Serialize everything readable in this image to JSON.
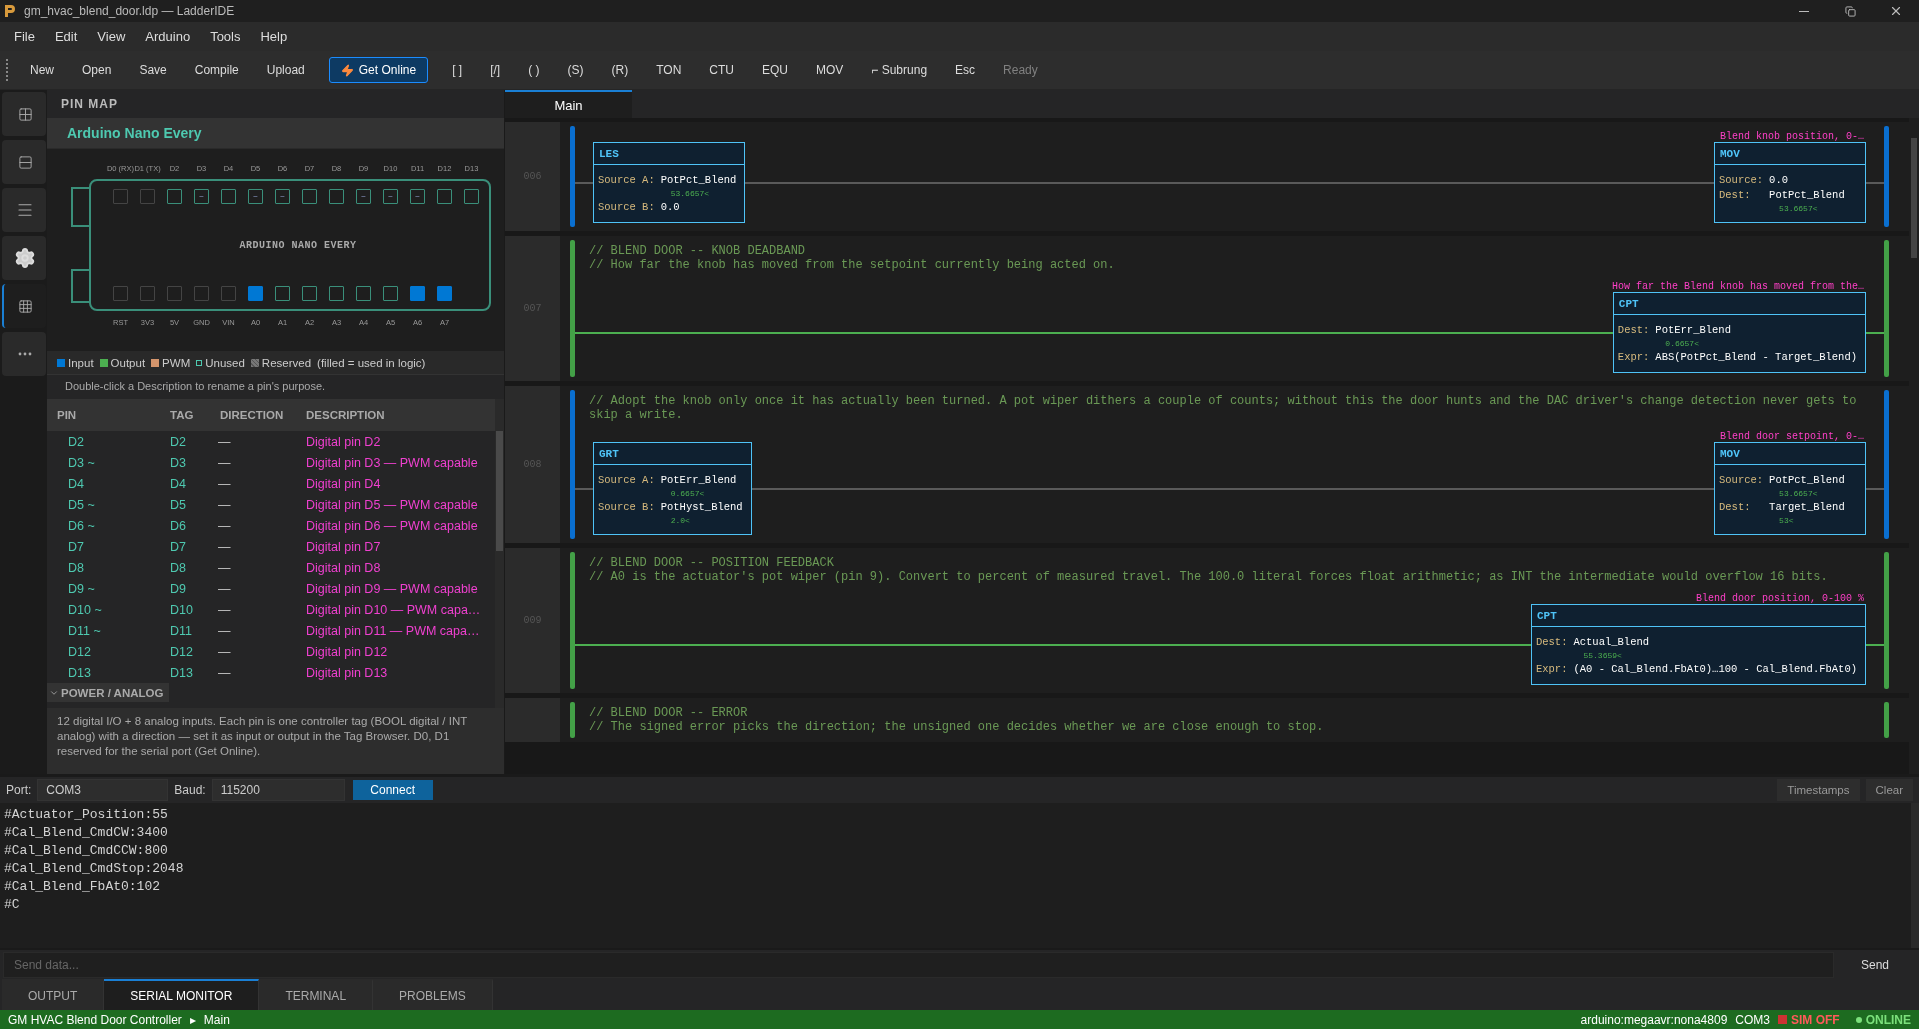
{
  "window": {
    "title": "gm_hvac_blend_door.ldp — LadderIDE"
  },
  "menu": [
    "File",
    "Edit",
    "View",
    "Arduino",
    "Tools",
    "Help"
  ],
  "toolbar": [
    {
      "label": "New",
      "kind": "action"
    },
    {
      "label": "Open",
      "kind": "action"
    },
    {
      "label": "Save",
      "kind": "action"
    },
    {
      "label": "Compile",
      "kind": "action"
    },
    {
      "label": "Upload",
      "kind": "action"
    },
    {
      "label": "Get Online",
      "kind": "primary"
    },
    {
      "label": "[ ]",
      "kind": "action"
    },
    {
      "label": "[/]",
      "kind": "action"
    },
    {
      "label": "( )",
      "kind": "action"
    },
    {
      "label": "(S)",
      "kind": "action"
    },
    {
      "label": "(R)",
      "kind": "action"
    },
    {
      "label": "TON",
      "kind": "action"
    },
    {
      "label": "CTU",
      "kind": "action"
    },
    {
      "label": "EQU",
      "kind": "action"
    },
    {
      "label": "MOV",
      "kind": "action"
    },
    {
      "label": "⌐ Subrung",
      "kind": "action"
    },
    {
      "label": "Esc",
      "kind": "action"
    },
    {
      "label": "Ready",
      "kind": "status"
    }
  ],
  "activity_bar": [
    {
      "kind": "grid",
      "selected": false
    },
    {
      "kind": "split",
      "selected": false
    },
    {
      "kind": "list",
      "selected": false
    },
    {
      "kind": "gear",
      "selected": false
    },
    {
      "kind": "table",
      "selected": true
    },
    {
      "kind": "more",
      "selected": false
    }
  ],
  "pin_map": {
    "title": "PIN MAP",
    "board_name": "Arduino Nano Every",
    "board_label": "ARDUINO NANO EVERY",
    "top_pins": [
      {
        "label": "D0 (RX)",
        "kind": "reserved"
      },
      {
        "label": "D1 (TX)",
        "kind": "reserved"
      },
      {
        "label": "D2",
        "kind": "unused"
      },
      {
        "label": "D3",
        "kind": "unused",
        "symbol": "~"
      },
      {
        "label": "D4",
        "kind": "unused"
      },
      {
        "label": "D5",
        "kind": "unused",
        "symbol": "~"
      },
      {
        "label": "D6",
        "kind": "unused",
        "symbol": "~"
      },
      {
        "label": "D7",
        "kind": "unused"
      },
      {
        "label": "D8",
        "kind": "unused"
      },
      {
        "label": "D9",
        "kind": "unused",
        "symbol": "~"
      },
      {
        "label": "D10",
        "kind": "unused",
        "symbol": "~"
      },
      {
        "label": "D11",
        "kind": "unused",
        "symbol": "~"
      },
      {
        "label": "D12",
        "kind": "unused"
      },
      {
        "label": "D13",
        "kind": "unused"
      }
    ],
    "bottom_pins": [
      {
        "label": "RST",
        "kind": "reserved"
      },
      {
        "label": "3V3",
        "kind": "reserved"
      },
      {
        "label": "5V",
        "kind": "reserved"
      },
      {
        "label": "GND",
        "kind": "reserved"
      },
      {
        "label": "VIN",
        "kind": "reserved"
      },
      {
        "label": "A0",
        "kind": "input"
      },
      {
        "label": "A1",
        "kind": "unused"
      },
      {
        "label": "A2",
        "kind": "unused"
      },
      {
        "label": "A3",
        "kind": "unused"
      },
      {
        "label": "A4",
        "kind": "unused"
      },
      {
        "label": "A5",
        "kind": "unused"
      },
      {
        "label": "A6",
        "kind": "input"
      },
      {
        "label": "A7",
        "kind": "input"
      }
    ],
    "legend": [
      {
        "label": "Input",
        "kind": "filled",
        "color": "#0078d4"
      },
      {
        "label": "Output",
        "kind": "filled",
        "color": "#4caf50"
      },
      {
        "label": "PWM",
        "kind": "filled",
        "color": "#d4956c"
      },
      {
        "label": "Unused",
        "kind": "outline",
        "color": "#4ec9b0"
      },
      {
        "label": "Reserved",
        "kind": "hatched",
        "color": "#777777"
      }
    ],
    "legend_note": "(filled = used in logic)",
    "hint": "Double-click a Description to rename a pin's purpose.",
    "table": {
      "columns": [
        "PIN",
        "TAG",
        "DIRECTION",
        "DESCRIPTION"
      ],
      "rows": [
        {
          "pin": "D2",
          "tag": "D2",
          "direction": "—",
          "description": "Digital pin D2"
        },
        {
          "pin": "D3 ~",
          "tag": "D3",
          "direction": "—",
          "description": "Digital pin D3 — PWM capable"
        },
        {
          "pin": "D4",
          "tag": "D4",
          "direction": "—",
          "description": "Digital pin D4"
        },
        {
          "pin": "D5 ~",
          "tag": "D5",
          "direction": "—",
          "description": "Digital pin D5 — PWM capable"
        },
        {
          "pin": "D6 ~",
          "tag": "D6",
          "direction": "—",
          "description": "Digital pin D6 — PWM capable"
        },
        {
          "pin": "D7",
          "tag": "D7",
          "direction": "—",
          "description": "Digital pin D7"
        },
        {
          "pin": "D8",
          "tag": "D8",
          "direction": "—",
          "description": "Digital pin D8"
        },
        {
          "pin": "D9 ~",
          "tag": "D9",
          "direction": "—",
          "description": "Digital pin D9 — PWM capable"
        },
        {
          "pin": "D10 ~",
          "tag": "D10",
          "direction": "—",
          "description": "Digital pin D10 — PWM capa…"
        },
        {
          "pin": "D11 ~",
          "tag": "D11",
          "direction": "—",
          "description": "Digital pin D11 — PWM capa…"
        },
        {
          "pin": "D12",
          "tag": "D12",
          "direction": "—",
          "description": "Digital pin D12"
        },
        {
          "pin": "D13",
          "tag": "D13",
          "direction": "—",
          "description": "Digital pin D13"
        }
      ]
    },
    "group": {
      "label": "POWER / ANALOG"
    },
    "description": "12 digital I/O + 8 analog inputs. Each pin is one controller tag (BOOL digital / INT analog) with a direction — set it as input or output in the Tag Browser. D0, D1 reserved for the serial port (Get Online)."
  },
  "editor_tabs": [
    {
      "label": "Main",
      "selected": true
    }
  ],
  "ladder": {
    "rungs": [
      {
        "number": "006",
        "energized": false,
        "left": [
          {
            "op": "LES",
            "fields": [
              {
                "label": "Source A:",
                "value": "PotPct_Blend",
                "live": "53.6657<"
              },
              {
                "label": "Source B:",
                "value": "0.0"
              }
            ]
          }
        ],
        "right": {
          "op": "MOV",
          "description": "Blend knob position, 0-…",
          "fields": [
            {
              "label": "Source:",
              "value": "0.0"
            },
            {
              "label": "Dest:",
              "value": "PotPct_Blend",
              "live": "53.6657<"
            }
          ]
        }
      },
      {
        "number": "007",
        "energized": true,
        "comments": [
          "// BLEND DOOR -- KNOB DEADBAND",
          "// How far the knob has moved from the setpoint currently being acted on."
        ],
        "right": {
          "op": "CPT",
          "description": "How far the Blend knob has moved from the…",
          "fields": [
            {
              "label": "Dest:",
              "value": "PotErr_Blend",
              "live": "0.6657<"
            },
            {
              "label": "Expr:",
              "value": "ABS(PotPct_Blend - Target_Blend)"
            }
          ]
        }
      },
      {
        "number": "008",
        "energized": false,
        "comments": [
          "// Adopt the knob only once it has actually been turned. A pot wiper dithers a couple of counts; without this the door hunts and the DAC driver's change detection never gets to",
          "skip a write."
        ],
        "left": [
          {
            "op": "GRT",
            "fields": [
              {
                "label": "Source A:",
                "value": "PotErr_Blend",
                "live": "0.6657<"
              },
              {
                "label": "Source B:",
                "value": "PotHyst_Blend",
                "live": "2.0<"
              }
            ]
          }
        ],
        "right": {
          "op": "MOV",
          "description": "Blend door setpoint, 0-…",
          "fields": [
            {
              "label": "Source:",
              "value": "PotPct_Blend",
              "live": "53.6657<"
            },
            {
              "label": "Dest:",
              "value": "Target_Blend",
              "live": "53<"
            }
          ]
        }
      },
      {
        "number": "009",
        "energized": true,
        "comments": [
          "// BLEND DOOR -- POSITION FEEDBACK",
          "// A0 is the actuator's pot wiper (pin 9). Convert to percent of measured travel. The 100.0 literal forces float arithmetic; as INT the intermediate would overflow 16 bits."
        ],
        "right": {
          "op": "CPT",
          "description": "Blend door position, 0-100 %",
          "fields": [
            {
              "label": "Dest:",
              "value": "Actual_Blend",
              "live": "55.3659<"
            },
            {
              "label": "Expr:",
              "value": "(A0 - Cal_Blend.FbAt0)…100 - Cal_Blend.FbAt0)"
            }
          ]
        }
      },
      {
        "energized": true,
        "comments": [
          "// BLEND DOOR -- ERROR",
          "// The signed error picks the direction; the unsigned one decides whether we are close enough to stop."
        ]
      }
    ]
  },
  "serial": {
    "port_label": "Port:",
    "port": "COM3",
    "baud_label": "Baud:",
    "baud": "115200",
    "connect": "Connect",
    "timestamps": "Timestamps",
    "clear": "Clear",
    "output": [
      "#Actuator_Position:55",
      "#Cal_Blend_CmdCW:3400",
      "#Cal_Blend_CmdCCW:800",
      "#Cal_Blend_CmdStop:2048",
      "#Cal_Blend_FbAt0:102",
      "#C"
    ],
    "send_placeholder": "Send data...",
    "send": "Send"
  },
  "bottom_tabs": [
    {
      "label": "OUTPUT",
      "selected": false
    },
    {
      "label": "SERIAL MONITOR",
      "selected": true
    },
    {
      "label": "TERMINAL",
      "selected": false
    },
    {
      "label": "PROBLEMS",
      "selected": false
    }
  ],
  "status_bar": {
    "project": "GM HVAC Blend Door Controller",
    "separator": "▸",
    "location": "Main",
    "board": "arduino:megaavr:nona4809",
    "port": "COM3",
    "sim": "SIM OFF",
    "online": "ONLINE"
  }
}
